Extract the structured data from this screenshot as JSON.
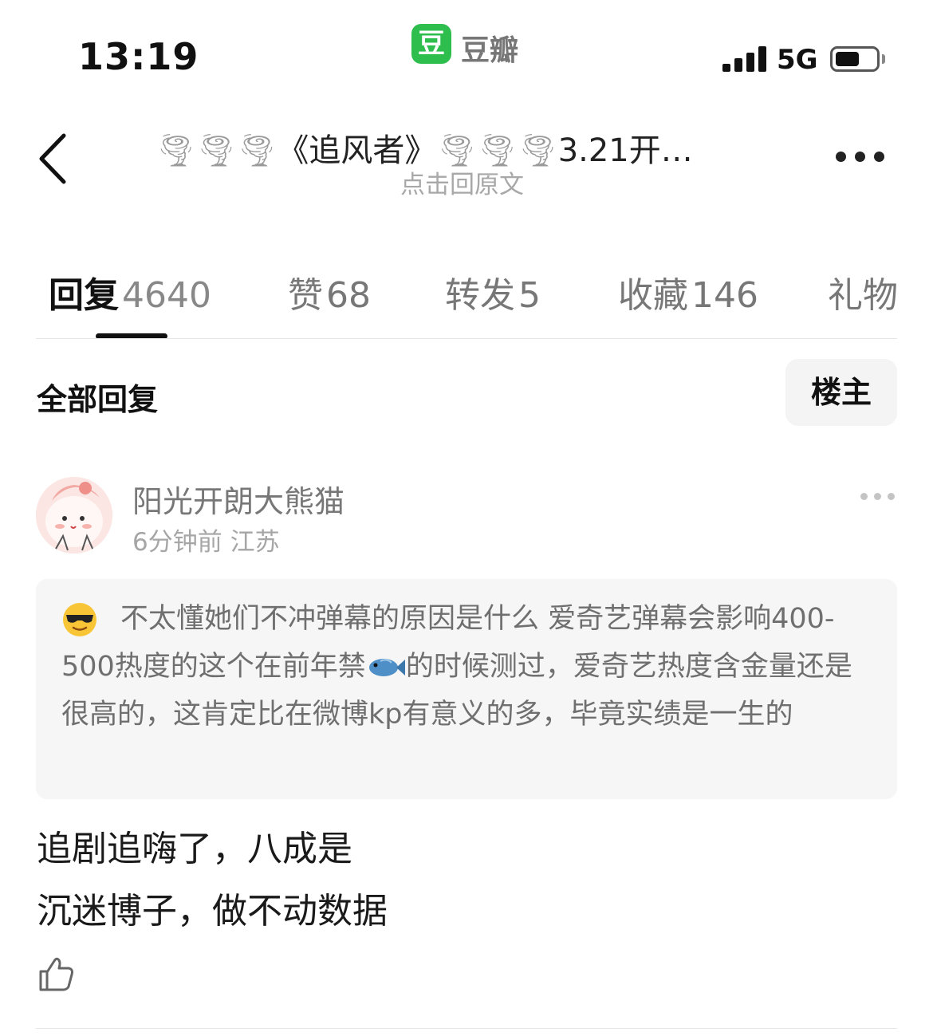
{
  "status_bar": {
    "time": "13:19",
    "app_logo_glyph": "豆",
    "app_name": "豆瓣",
    "network": "5G",
    "battery_level": 0.6
  },
  "nav": {
    "title_decor": "🌪🌪🌪",
    "title_text": "《追风者》",
    "title_decor_2": "🌪🌪🌪",
    "title_suffix": "3.21开…",
    "subtitle": "点击回原文"
  },
  "tabs": [
    {
      "label": "回复",
      "count": "4640",
      "active": true
    },
    {
      "label": "赞",
      "count": "68"
    },
    {
      "label": "转发",
      "count": "5"
    },
    {
      "label": "收藏",
      "count": "146"
    },
    {
      "label": "礼物",
      "count": ""
    }
  ],
  "filter": {
    "all_replies": "全部回复",
    "op_only": "楼主"
  },
  "comment": {
    "username": "阳光开朗大熊猫",
    "meta": "6分钟前 江苏",
    "quote_part1": "不太懂她们不冲弹幕的原因是什么 爱奇艺弹幕会影响400-500热度的这个在前年禁",
    "quote_part2": "的时候测过，爱奇艺热度含金量还是很高的，这肯定比在微博kp有意义的多，毕竟实绩是一生的",
    "reply_line1": "追剧追嗨了，八成是",
    "reply_line2": "沉迷博子，做不动数据"
  },
  "colors": {
    "brand_green": "#2dbe4e",
    "quote_bg": "#f6f6f6"
  }
}
